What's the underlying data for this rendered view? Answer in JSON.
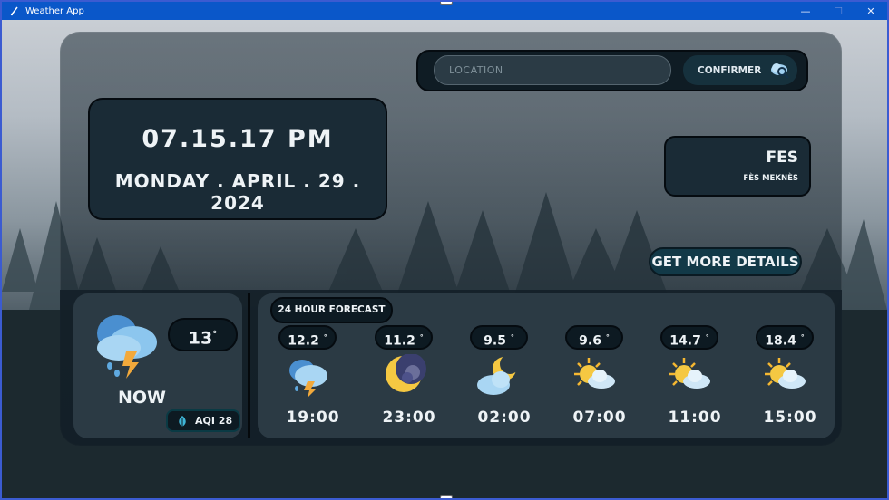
{
  "window": {
    "title": "Weather App",
    "minimize": "—",
    "maximize": "☐",
    "close": "✕"
  },
  "search": {
    "placeholder": "LOCATION",
    "confirm_label": "CONFIRMER"
  },
  "clock": {
    "time": "07.15.17 PM",
    "date": "MONDAY . APRIL . 29 . 2024"
  },
  "city": {
    "name": "FES",
    "region": "FÈS MEKNÈS"
  },
  "details_button": "GET MORE DETAILS",
  "current": {
    "temp": "13",
    "degree": "°",
    "label": "NOW",
    "aqi": "AQI 28",
    "icon": "storm-cloud-icon"
  },
  "forecast": {
    "title": "24 HOUR FORECAST",
    "items": [
      {
        "temp": "12.2",
        "degree": "°",
        "time": "19:00",
        "icon": "storm-icon"
      },
      {
        "temp": "11.2",
        "degree": "°",
        "time": "23:00",
        "icon": "moon-cloud-icon"
      },
      {
        "temp": "9.5",
        "degree": "°",
        "time": "02:00",
        "icon": "moon-cloud-icon"
      },
      {
        "temp": "9.6",
        "degree": "°",
        "time": "07:00",
        "icon": "sun-cloud-icon"
      },
      {
        "temp": "14.7",
        "degree": "°",
        "time": "11:00",
        "icon": "sun-cloud-icon"
      },
      {
        "temp": "18.4",
        "degree": "°",
        "time": "15:00",
        "icon": "sun-cloud-icon"
      }
    ]
  },
  "colors": {
    "titlebar": "#0a57c9",
    "card": "#1a2b36",
    "accent": "#123947"
  }
}
